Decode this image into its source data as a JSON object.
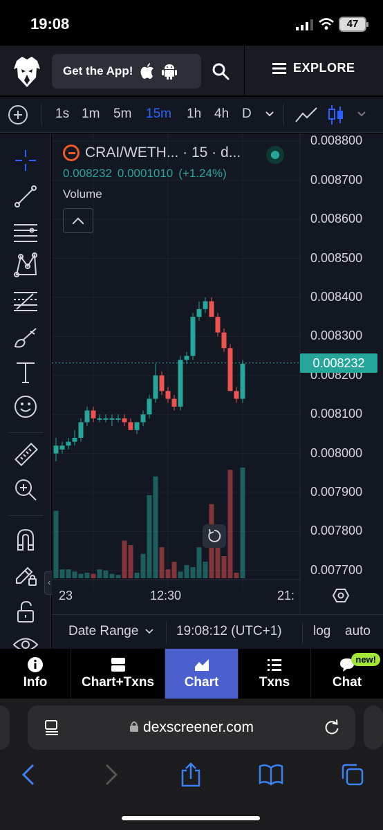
{
  "status_bar": {
    "time": "19:08",
    "battery": "47"
  },
  "header": {
    "get_app_label": "Get the App!",
    "explore_label": "EXPLORE"
  },
  "toolbar": {
    "intervals": [
      "1s",
      "1m",
      "5m",
      "15m",
      "1h",
      "4h",
      "D"
    ],
    "active_interval": "15m"
  },
  "legend": {
    "pair": "CRAI/WETH... · 15 · d...",
    "price": "0.008232",
    "change": "0.0001010",
    "change_pct": "(+1.24%)",
    "volume_label": "Volume"
  },
  "colors": {
    "up": "#26a69a",
    "down": "#ef5350",
    "bg": "#131722",
    "accent": "#4c5fcf"
  },
  "chart_data": {
    "type": "candlestick",
    "y_ticks": [
      "0.008800",
      "0.008700",
      "0.008600",
      "0.008500",
      "0.008400",
      "0.008300",
      "0.008200",
      "0.008100",
      "0.008000",
      "0.007900",
      "0.007800",
      "0.007700"
    ],
    "ylim": [
      0.00765,
      0.00882
    ],
    "x_ticks": [
      "23",
      "12:30",
      "21:"
    ],
    "last_price": "0.008232",
    "candles": [
      {
        "o": 0.008,
        "h": 0.00804,
        "l": 0.00798,
        "c": 0.00802,
        "v": 0.61
      },
      {
        "o": 0.00801,
        "h": 0.00803,
        "l": 0.008,
        "c": 0.00802,
        "v": 0.08
      },
      {
        "o": 0.00802,
        "h": 0.00804,
        "l": 0.00801,
        "c": 0.00803,
        "v": 0.08
      },
      {
        "o": 0.00803,
        "h": 0.00806,
        "l": 0.00802,
        "c": 0.00804,
        "v": 0.06
      },
      {
        "o": 0.00804,
        "h": 0.00809,
        "l": 0.00803,
        "c": 0.00808,
        "v": 0.04
      },
      {
        "o": 0.00808,
        "h": 0.00812,
        "l": 0.00807,
        "c": 0.00811,
        "v": 0.05
      },
      {
        "o": 0.00811,
        "h": 0.00812,
        "l": 0.00808,
        "c": 0.00809,
        "v": 0.04
      },
      {
        "o": 0.00809,
        "h": 0.0081,
        "l": 0.00808,
        "c": 0.00809,
        "v": 0.08
      },
      {
        "o": 0.00809,
        "h": 0.0081,
        "l": 0.00808,
        "c": 0.00809,
        "v": 0.07
      },
      {
        "o": 0.00809,
        "h": 0.0081,
        "l": 0.00807,
        "c": 0.00809,
        "v": 0.04
      },
      {
        "o": 0.00809,
        "h": 0.0081,
        "l": 0.00808,
        "c": 0.00809,
        "v": 0.03
      },
      {
        "o": 0.00809,
        "h": 0.0081,
        "l": 0.00807,
        "c": 0.00808,
        "v": 0.34
      },
      {
        "o": 0.00808,
        "h": 0.00809,
        "l": 0.00806,
        "c": 0.00806,
        "v": 0.3
      },
      {
        "o": 0.00806,
        "h": 0.00808,
        "l": 0.00805,
        "c": 0.00808,
        "v": 0.05
      },
      {
        "o": 0.00808,
        "h": 0.00811,
        "l": 0.00807,
        "c": 0.0081,
        "v": 0.22
      },
      {
        "o": 0.0081,
        "h": 0.00815,
        "l": 0.00809,
        "c": 0.00814,
        "v": 0.75
      },
      {
        "o": 0.00814,
        "h": 0.00823,
        "l": 0.00813,
        "c": 0.0082,
        "v": 0.92
      },
      {
        "o": 0.0082,
        "h": 0.00821,
        "l": 0.00815,
        "c": 0.00816,
        "v": 0.28
      },
      {
        "o": 0.00816,
        "h": 0.00817,
        "l": 0.00813,
        "c": 0.00814,
        "v": 0.08
      },
      {
        "o": 0.00814,
        "h": 0.00815,
        "l": 0.00811,
        "c": 0.00812,
        "v": 0.15
      },
      {
        "o": 0.00812,
        "h": 0.00825,
        "l": 0.00811,
        "c": 0.00824,
        "v": 0.06
      },
      {
        "o": 0.00824,
        "h": 0.00826,
        "l": 0.00823,
        "c": 0.00825,
        "v": 0.12
      },
      {
        "o": 0.00825,
        "h": 0.00836,
        "l": 0.00824,
        "c": 0.00835,
        "v": 0.1
      },
      {
        "o": 0.00835,
        "h": 0.00839,
        "l": 0.00834,
        "c": 0.00837,
        "v": 0.28
      },
      {
        "o": 0.00837,
        "h": 0.0084,
        "l": 0.00836,
        "c": 0.00839,
        "v": 0.15
      },
      {
        "o": 0.00839,
        "h": 0.0084,
        "l": 0.00835,
        "c": 0.00835,
        "v": 0.67
      },
      {
        "o": 0.00835,
        "h": 0.00836,
        "l": 0.0083,
        "c": 0.00831,
        "v": 0.4
      },
      {
        "o": 0.00831,
        "h": 0.00832,
        "l": 0.00826,
        "c": 0.00827,
        "v": 0.2
      },
      {
        "o": 0.00827,
        "h": 0.00828,
        "l": 0.00816,
        "c": 0.00816,
        "v": 0.98
      },
      {
        "o": 0.00816,
        "h": 0.00817,
        "l": 0.00813,
        "c": 0.00814,
        "v": 0.05
      },
      {
        "o": 0.00814,
        "h": 0.00824,
        "l": 0.00813,
        "c": 0.00823,
        "v": 1.0
      }
    ]
  },
  "chart_footer": {
    "date_range_label": "Date Range",
    "time_readout": "19:08:12 (UTC+1)",
    "log_label": "log",
    "auto_label": "auto"
  },
  "nav_tabs": [
    {
      "label": "Info",
      "icon": "info-icon"
    },
    {
      "label": "Chart+Txns",
      "icon": "split-view-icon"
    },
    {
      "label": "Chart",
      "icon": "chart-icon",
      "active": true
    },
    {
      "label": "Txns",
      "icon": "list-icon"
    },
    {
      "label": "Chat",
      "icon": "chat-bubble-icon",
      "badge": "new!"
    }
  ],
  "browser": {
    "url": "dexscreener.com"
  }
}
